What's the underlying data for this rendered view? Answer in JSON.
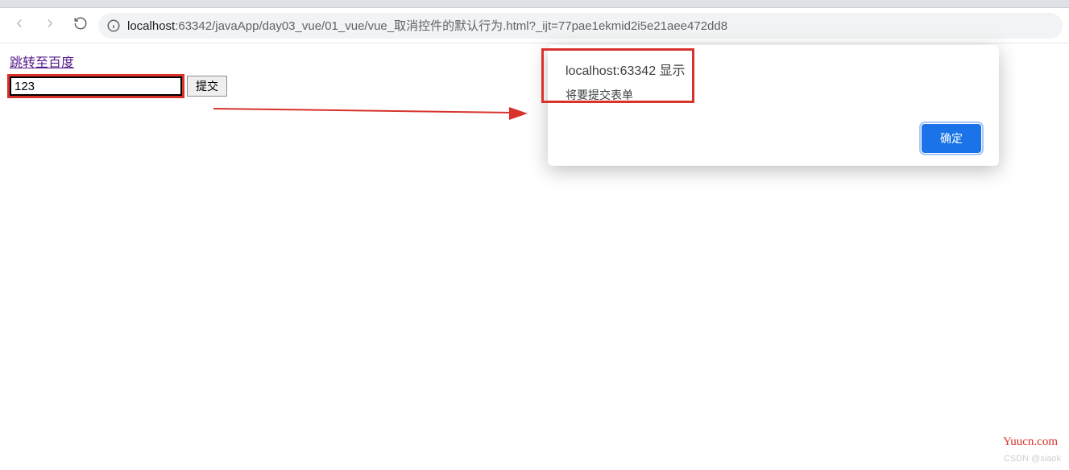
{
  "url": {
    "host_prefix": "localhost",
    "host_suffix": ":63342",
    "path": "/javaApp/day03_vue/01_vue/vue_取消控件的默认行为.html?_ijt=77pae1ekmid2i5e21aee472dd8"
  },
  "page": {
    "link_text": "跳转至百度",
    "input_value": "123",
    "submit_label": "提交"
  },
  "dialog": {
    "title": "localhost:63342 显示",
    "message": "将要提交表单",
    "ok_label": "确定"
  },
  "watermarks": {
    "brand": "Yuucn.com",
    "csdn": "CSDN @siaok"
  },
  "annotation_colors": {
    "highlight": "#d8322b",
    "primary_button": "#1a73e8"
  }
}
